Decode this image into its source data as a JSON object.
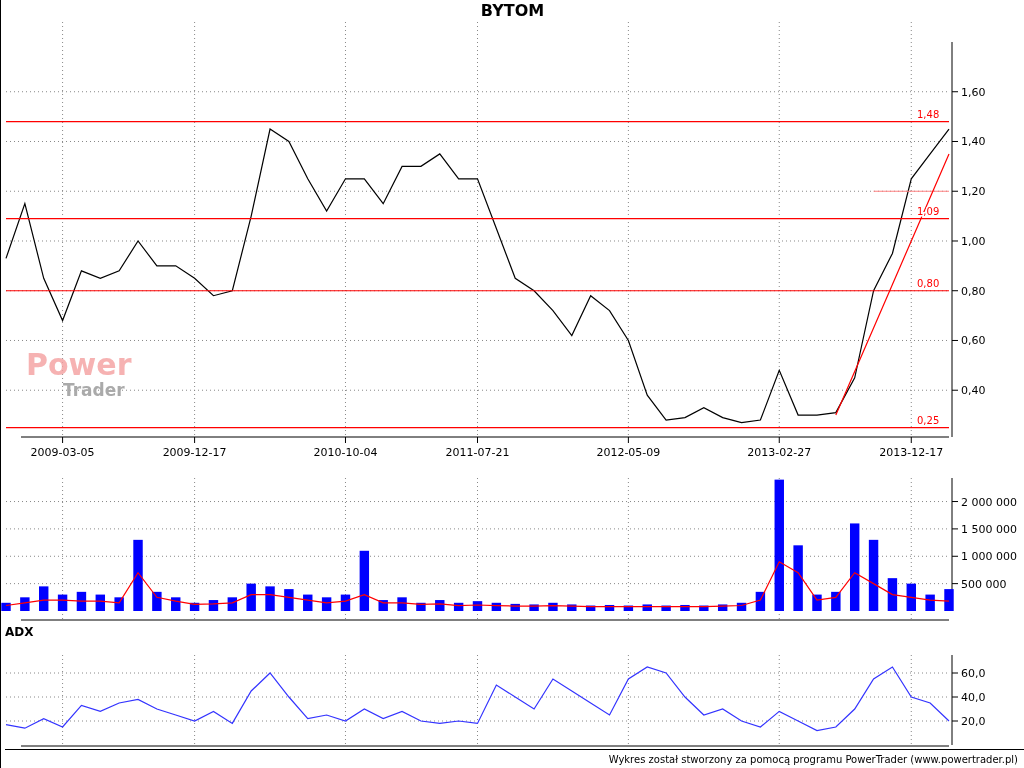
{
  "title": "BYTOM",
  "logo": {
    "top": "Power",
    "bottom": "Trader"
  },
  "price_panel": {
    "chart_data": {
      "type": "line",
      "categories": [
        null,
        null,
        null,
        "2009-03-05",
        null,
        null,
        null,
        null,
        null,
        null,
        "2009-12-17",
        null,
        null,
        null,
        null,
        null,
        null,
        null,
        "2010-10-04",
        null,
        null,
        null,
        null,
        null,
        null,
        "2011-07-21",
        null,
        null,
        null,
        null,
        null,
        null,
        null,
        "2012-05-09",
        null,
        null,
        null,
        null,
        null,
        null,
        null,
        "2013-02-27",
        null,
        null,
        null,
        null,
        null,
        null,
        "2013-12-17",
        null,
        null
      ],
      "series": [
        {
          "color": "#000000",
          "values": [
            0.93,
            1.15,
            0.85,
            0.68,
            0.88,
            0.85,
            0.88,
            1.0,
            0.9,
            0.9,
            0.85,
            0.78,
            0.8,
            1.1,
            1.45,
            1.4,
            1.25,
            1.12,
            1.25,
            1.25,
            1.15,
            1.3,
            1.3,
            1.35,
            1.25,
            1.25,
            1.05,
            0.85,
            0.8,
            0.72,
            0.62,
            0.78,
            0.72,
            0.6,
            0.38,
            0.28,
            0.29,
            0.33,
            0.29,
            0.27,
            0.28,
            0.48,
            0.3,
            0.3,
            0.31,
            0.45,
            0.8,
            0.95,
            1.25,
            1.35,
            1.45
          ]
        },
        {
          "color": "#ff8080",
          "values": [
            null,
            null,
            null,
            null,
            null,
            null,
            null,
            null,
            null,
            null,
            null,
            null,
            null,
            null,
            null,
            null,
            null,
            null,
            null,
            null,
            null,
            null,
            null,
            null,
            null,
            null,
            null,
            null,
            null,
            null,
            null,
            null,
            null,
            null,
            null,
            null,
            null,
            null,
            null,
            null,
            null,
            null,
            null,
            null,
            null,
            null,
            1.2,
            1.2,
            1.2,
            1.2,
            1.2
          ]
        },
        {
          "color": "#ff0000",
          "values": [
            null,
            null,
            null,
            null,
            null,
            null,
            null,
            null,
            null,
            null,
            null,
            null,
            null,
            null,
            null,
            null,
            null,
            null,
            null,
            null,
            null,
            null,
            null,
            null,
            null,
            null,
            null,
            null,
            null,
            null,
            null,
            null,
            null,
            null,
            null,
            null,
            null,
            null,
            null,
            null,
            null,
            null,
            null,
            null,
            0.3,
            0.475,
            0.65,
            0.825,
            1.0,
            1.175,
            1.35
          ]
        },
        {
          "name": "1,48",
          "color": "#ff0000",
          "values": [
            1.48,
            1.48,
            1.48,
            1.48,
            1.48,
            1.48,
            1.48,
            1.48,
            1.48,
            1.48,
            1.48,
            1.48,
            1.48,
            1.48,
            1.48,
            1.48,
            1.48,
            1.48,
            1.48,
            1.48,
            1.48,
            1.48,
            1.48,
            1.48,
            1.48,
            1.48,
            1.48,
            1.48,
            1.48,
            1.48,
            1.48,
            1.48,
            1.48,
            1.48,
            1.48,
            1.48,
            1.48,
            1.48,
            1.48,
            1.48,
            1.48,
            1.48,
            1.48,
            1.48,
            1.48,
            1.48,
            1.48,
            1.48,
            1.48,
            1.48,
            1.48
          ]
        },
        {
          "name": "1,09",
          "color": "#ff0000",
          "values": [
            1.09,
            1.09,
            1.09,
            1.09,
            1.09,
            1.09,
            1.09,
            1.09,
            1.09,
            1.09,
            1.09,
            1.09,
            1.09,
            1.09,
            1.09,
            1.09,
            1.09,
            1.09,
            1.09,
            1.09,
            1.09,
            1.09,
            1.09,
            1.09,
            1.09,
            1.09,
            1.09,
            1.09,
            1.09,
            1.09,
            1.09,
            1.09,
            1.09,
            1.09,
            1.09,
            1.09,
            1.09,
            1.09,
            1.09,
            1.09,
            1.09,
            1.09,
            1.09,
            1.09,
            1.09,
            1.09,
            1.09,
            1.09,
            1.09,
            1.09,
            1.09
          ]
        },
        {
          "name": "0,80",
          "color": "#ff0000",
          "values": [
            0.8,
            0.8,
            0.8,
            0.8,
            0.8,
            0.8,
            0.8,
            0.8,
            0.8,
            0.8,
            0.8,
            0.8,
            0.8,
            0.8,
            0.8,
            0.8,
            0.8,
            0.8,
            0.8,
            0.8,
            0.8,
            0.8,
            0.8,
            0.8,
            0.8,
            0.8,
            0.8,
            0.8,
            0.8,
            0.8,
            0.8,
            0.8,
            0.8,
            0.8,
            0.8,
            0.8,
            0.8,
            0.8,
            0.8,
            0.8,
            0.8,
            0.8,
            0.8,
            0.8,
            0.8,
            0.8,
            0.8,
            0.8,
            0.8,
            0.8,
            0.8
          ]
        },
        {
          "name": "0,25",
          "color": "#ff0000",
          "values": [
            0.25,
            0.25,
            0.25,
            0.25,
            0.25,
            0.25,
            0.25,
            0.25,
            0.25,
            0.25,
            0.25,
            0.25,
            0.25,
            0.25,
            0.25,
            0.25,
            0.25,
            0.25,
            0.25,
            0.25,
            0.25,
            0.25,
            0.25,
            0.25,
            0.25,
            0.25,
            0.25,
            0.25,
            0.25,
            0.25,
            0.25,
            0.25,
            0.25,
            0.25,
            0.25,
            0.25,
            0.25,
            0.25,
            0.25,
            0.25,
            0.25,
            0.25,
            0.25,
            0.25,
            0.25,
            0.25,
            0.25,
            0.25,
            0.25,
            0.25,
            0.25
          ]
        }
      ],
      "grid": true,
      "ylim": [
        0.22,
        1.8
      ],
      "yticks": [
        {
          "value": 0.4,
          "label": "0,40"
        },
        {
          "value": 0.6,
          "label": "0,60"
        },
        {
          "value": 0.8,
          "label": "0,80"
        },
        {
          "value": 1.0,
          "label": "1,00"
        },
        {
          "value": 1.2,
          "label": "1,20"
        },
        {
          "value": 1.4,
          "label": "1,40"
        },
        {
          "value": 1.6,
          "label": "1,60"
        }
      ]
    }
  },
  "volume_panel": {
    "chart_data": {
      "type": "bar",
      "categories": [
        null,
        null,
        null,
        null,
        null,
        null,
        null,
        null,
        null,
        null,
        null,
        null,
        null,
        null,
        null,
        null,
        null,
        null,
        null,
        null,
        null,
        null,
        null,
        null,
        null,
        null,
        null,
        null,
        null,
        null,
        null,
        null,
        null,
        null,
        null,
        null,
        null,
        null,
        null,
        null,
        null,
        null,
        null,
        null,
        null,
        null,
        null,
        null,
        null,
        null,
        null
      ],
      "grid": true,
      "series": [
        {
          "color": "#0000ff",
          "values": [
            150000,
            250000,
            450000,
            300000,
            350000,
            300000,
            250000,
            1300000,
            350000,
            250000,
            150000,
            200000,
            250000,
            500000,
            450000,
            400000,
            300000,
            250000,
            300000,
            1100000,
            200000,
            250000,
            150000,
            200000,
            150000,
            180000,
            150000,
            130000,
            120000,
            150000,
            120000,
            100000,
            110000,
            100000,
            120000,
            100000,
            110000,
            100000,
            120000,
            150000,
            350000,
            2400000,
            1200000,
            300000,
            350000,
            1600000,
            1300000,
            600000,
            500000,
            300000,
            400000
          ]
        },
        {
          "type": "line",
          "color": "#ff0000",
          "values": [
            100000,
            150000,
            200000,
            200000,
            180000,
            180000,
            150000,
            700000,
            250000,
            180000,
            120000,
            130000,
            150000,
            300000,
            300000,
            250000,
            200000,
            150000,
            180000,
            300000,
            150000,
            150000,
            120000,
            130000,
            100000,
            110000,
            100000,
            90000,
            90000,
            100000,
            90000,
            80000,
            80000,
            80000,
            80000,
            80000,
            80000,
            80000,
            90000,
            100000,
            200000,
            900000,
            700000,
            200000,
            250000,
            700000,
            500000,
            300000,
            250000,
            200000,
            180000
          ]
        }
      ],
      "ylim": [
        0,
        2430000
      ],
      "yticks": [
        {
          "value": 500000,
          "label": "500 000"
        },
        {
          "value": 1000000,
          "label": "1 000 000"
        },
        {
          "value": 1500000,
          "label": "1 500 000"
        },
        {
          "value": 2000000,
          "label": "2 000 000"
        }
      ]
    }
  },
  "adx_panel": {
    "label": "ADX",
    "chart_data": {
      "type": "line",
      "categories": [
        null,
        null,
        null,
        null,
        null,
        null,
        null,
        null,
        null,
        null,
        null,
        null,
        null,
        null,
        null,
        null,
        null,
        null,
        null,
        null,
        null,
        null,
        null,
        null,
        null,
        null,
        null,
        null,
        null,
        null,
        null,
        null,
        null,
        null,
        null,
        null,
        null,
        null,
        null,
        null,
        null,
        null,
        null,
        null,
        null,
        null,
        null,
        null,
        null,
        null,
        null
      ],
      "series": [
        {
          "color": "#3333ff",
          "values": [
            17,
            14,
            22,
            15,
            33,
            28,
            35,
            38,
            30,
            25,
            20,
            28,
            18,
            45,
            60,
            40,
            22,
            25,
            20,
            30,
            22,
            28,
            20,
            18,
            20,
            18,
            50,
            40,
            30,
            55,
            45,
            35,
            25,
            55,
            65,
            60,
            40,
            25,
            30,
            20,
            15,
            28,
            20,
            12,
            15,
            30,
            55,
            65,
            40,
            35,
            20
          ]
        }
      ],
      "grid": true,
      "ylim": [
        0,
        75
      ],
      "yticks": [
        {
          "value": 20,
          "label": "20,0"
        },
        {
          "value": 40,
          "label": "40,0"
        },
        {
          "value": 60,
          "label": "60,0"
        }
      ]
    }
  },
  "footer": "Wykres został stworzony za pomocą programu PowerTrader (www.powertrader.pl)"
}
